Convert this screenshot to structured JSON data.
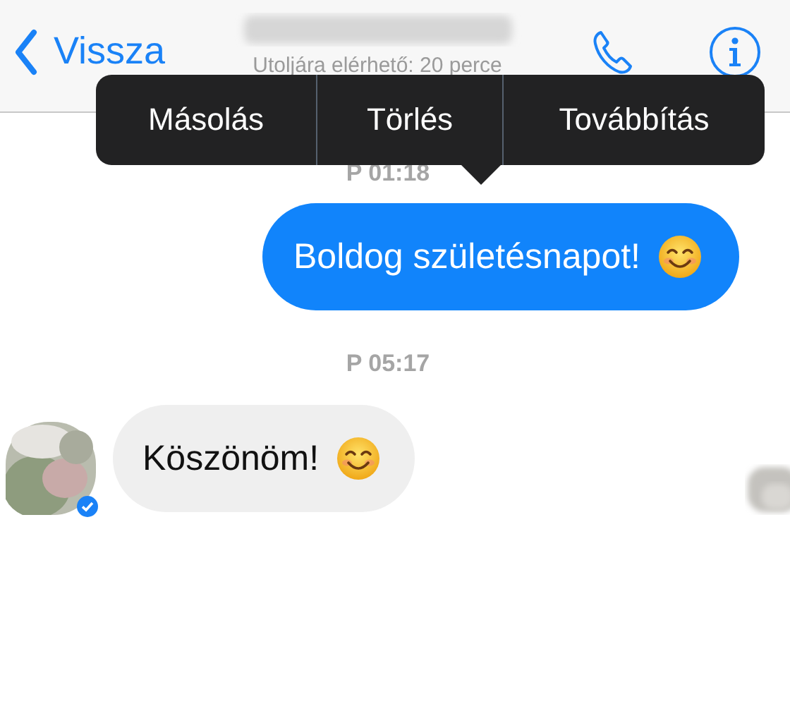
{
  "header": {
    "back_label": "Vissza",
    "subtitle": "Utoljára elérhető: 20 perce"
  },
  "context_menu": [
    "Másolás",
    "Törlés",
    "Továbbítás"
  ],
  "messages": [
    {
      "kind": "time",
      "text": "P 01:18"
    },
    {
      "kind": "sent",
      "text": "Boldog születésnapot!",
      "emoji": true
    },
    {
      "kind": "time",
      "text": "P 05:17"
    },
    {
      "kind": "received",
      "text": "Köszönöm!",
      "emoji": true,
      "verified": true
    }
  ]
}
